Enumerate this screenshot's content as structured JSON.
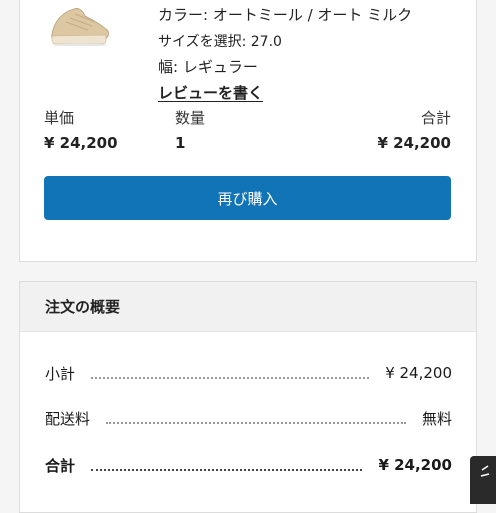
{
  "product": {
    "image_icon": "running-shoe",
    "color_label": "カラー: ",
    "color_value": "オートミール / オート ミルク",
    "size_label": "サイズを選択: ",
    "size_value": "27.0",
    "width_label": "幅: ",
    "width_value": "レギュラー",
    "review_link": "レビューを書く"
  },
  "line": {
    "unit_price_header": "単価",
    "quantity_header": "数量",
    "total_header": "合計",
    "unit_price": "¥ 24,200",
    "quantity": "1",
    "total": "¥ 24,200"
  },
  "buy_again_label": "再び購入",
  "summary": {
    "title": "注文の概要",
    "subtotal_label": "小計",
    "subtotal_value": "¥ 24,200",
    "shipping_label": "配送料",
    "shipping_value": "無料",
    "total_label": "合計",
    "total_value": "¥ 24,200"
  },
  "colors": {
    "button": "#1074b6",
    "shoe": "#dcc7a3",
    "summary_header_bg": "#f1f1f1",
    "feedback_tab": "#2a2a2a"
  }
}
